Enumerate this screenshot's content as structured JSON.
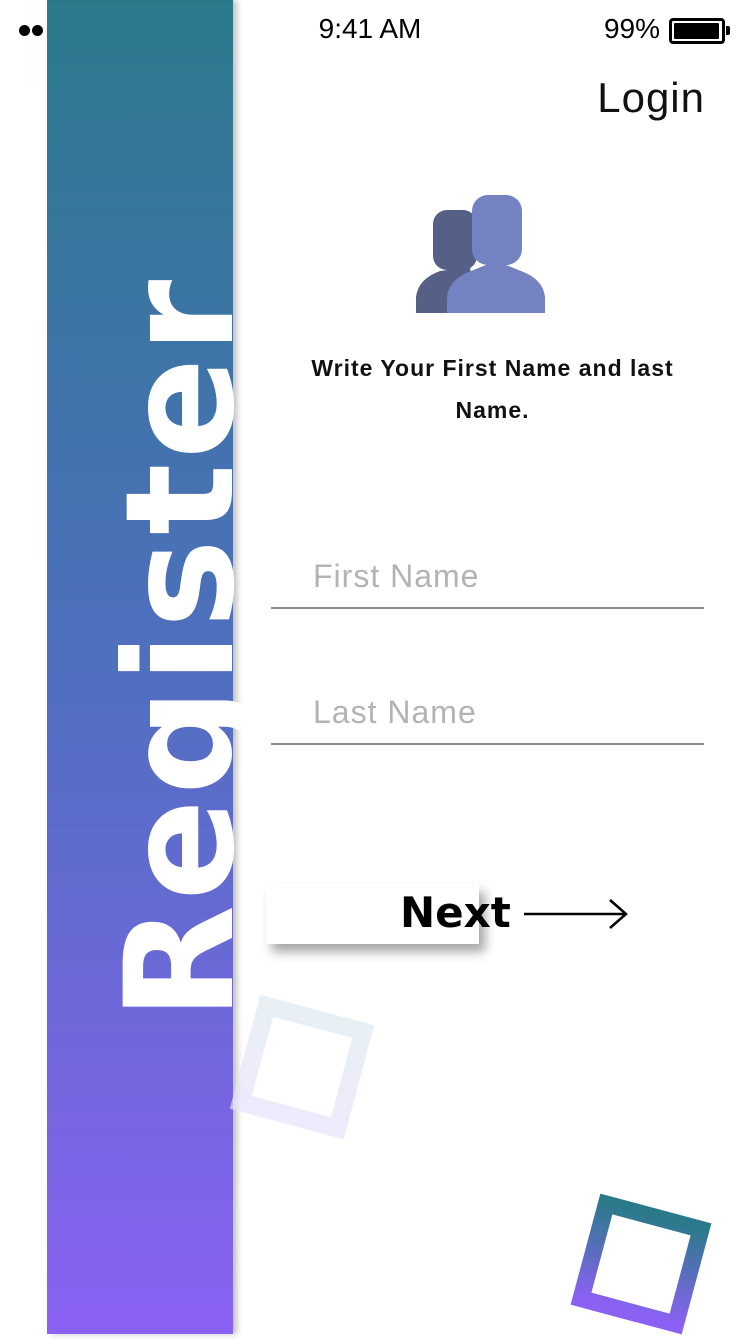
{
  "status_bar": {
    "time": "9:41 AM",
    "battery_percent": "99%",
    "battery_level": 0.99
  },
  "header": {
    "login_label": "Login"
  },
  "side": {
    "title": "Register"
  },
  "main": {
    "icon": "users-icon",
    "instruction": "Write Your First Name and last Name.",
    "fields": {
      "first_name": {
        "placeholder": "First Name",
        "value": ""
      },
      "last_name": {
        "placeholder": "Last Name",
        "value": ""
      }
    },
    "next_label": "Next",
    "next_icon": "arrow-right-icon"
  },
  "colors": {
    "gradient_top": "#2b7a8c",
    "gradient_bottom": "#8b61f3",
    "icon_back": "#566086",
    "icon_front": "#7482c2"
  }
}
